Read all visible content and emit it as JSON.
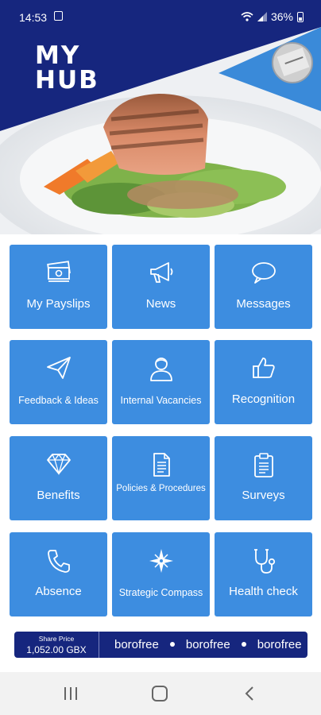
{
  "status": {
    "time": "14:53",
    "battery": "36%"
  },
  "brand": {
    "line1": "MY",
    "line2": "HUB"
  },
  "tiles": [
    {
      "label": "My Payslips",
      "icon": "money-icon"
    },
    {
      "label": "News",
      "icon": "megaphone-icon"
    },
    {
      "label": "Messages",
      "icon": "chat-bubble-icon"
    },
    {
      "label": "Feedback & Ideas",
      "icon": "paper-plane-icon"
    },
    {
      "label": "Internal Vacancies",
      "icon": "person-icon"
    },
    {
      "label": "Recognition",
      "icon": "thumbs-up-icon"
    },
    {
      "label": "Benefits",
      "icon": "diamond-icon"
    },
    {
      "label": "Policies & Procedures",
      "icon": "document-icon"
    },
    {
      "label": "Surveys",
      "icon": "clipboard-icon"
    },
    {
      "label": "Absence",
      "icon": "phone-icon"
    },
    {
      "label": "Strategic Compass",
      "icon": "compass-icon"
    },
    {
      "label": "Health check",
      "icon": "stethoscope-icon"
    }
  ],
  "ticker": {
    "share_label": "Share Price",
    "share_price": "1,052.00 GBX",
    "items": [
      "borofree",
      "borofree",
      "borofree"
    ]
  },
  "colors": {
    "navy": "#16267e",
    "tile_blue": "#3d8de0",
    "accent_blue": "#3a8ad9"
  }
}
